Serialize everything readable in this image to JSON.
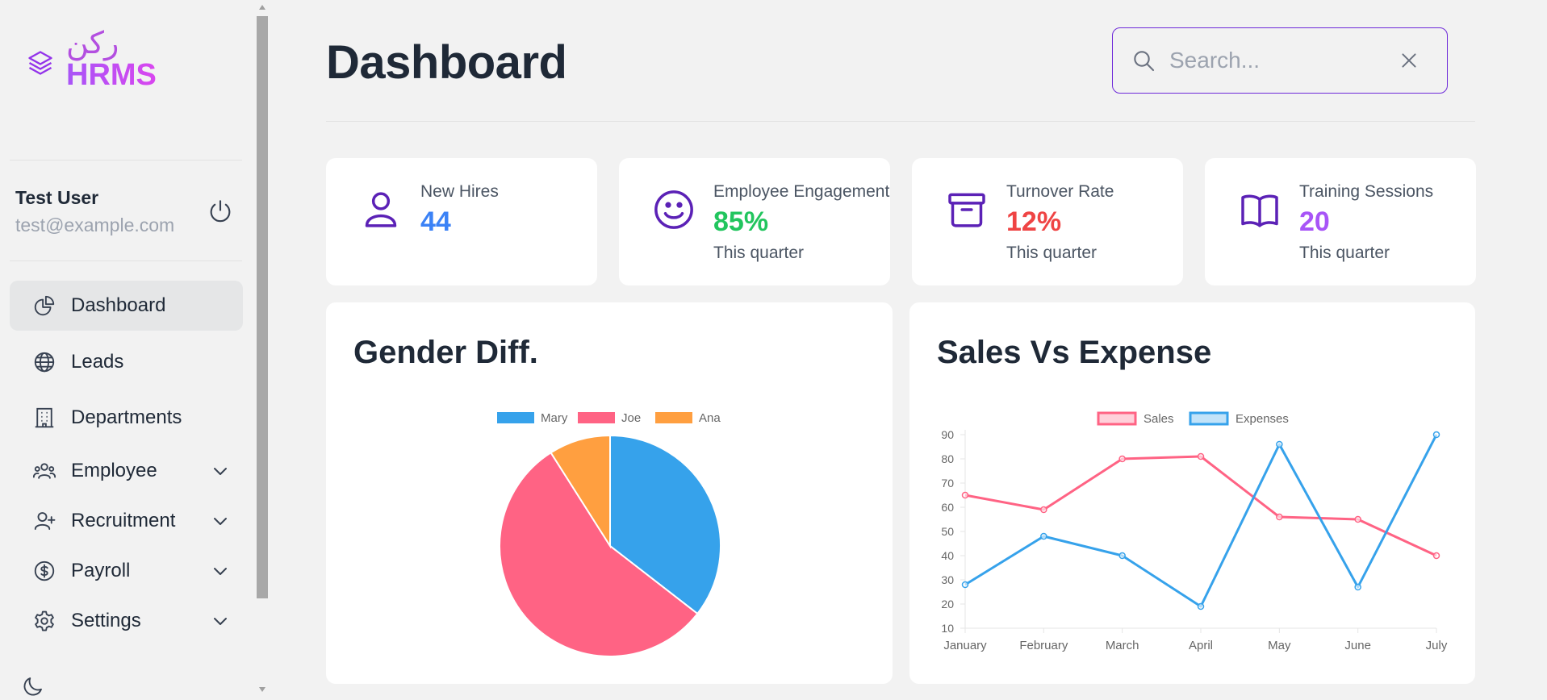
{
  "brand": {
    "arabic": "ركن",
    "name": "HRMS",
    "logo_icon": "layers-icon"
  },
  "user": {
    "name": "Test User",
    "email": "test@example.com"
  },
  "nav": [
    {
      "label": "Dashboard",
      "icon": "pie-chart-icon",
      "active": true,
      "expandable": false
    },
    {
      "label": "Leads",
      "icon": "globe-icon",
      "active": false,
      "expandable": false
    },
    {
      "label": "Departments",
      "icon": "building-icon",
      "active": false,
      "expandable": false
    },
    {
      "label": "Employee",
      "icon": "users-icon",
      "active": false,
      "expandable": true
    },
    {
      "label": "Recruitment",
      "icon": "user-plus-icon",
      "active": false,
      "expandable": true
    },
    {
      "label": "Payroll",
      "icon": "dollar-icon",
      "active": false,
      "expandable": true
    },
    {
      "label": "Settings",
      "icon": "gear-icon",
      "active": false,
      "expandable": true
    }
  ],
  "page": {
    "title": "Dashboard"
  },
  "search": {
    "placeholder": "Search..."
  },
  "stats": [
    {
      "label": "New Hires",
      "value": "44",
      "sub": "",
      "color": "#3b82f6",
      "icon": "user-icon"
    },
    {
      "label": "Employee Engagement",
      "value": "85%",
      "sub": "This quarter",
      "color": "#22c55e",
      "icon": "smile-icon"
    },
    {
      "label": "Turnover Rate",
      "value": "12%",
      "sub": "This quarter",
      "color": "#ef4444",
      "icon": "archive-icon"
    },
    {
      "label": "Training Sessions",
      "value": "20",
      "sub": "This quarter",
      "color": "#a855f7",
      "icon": "book-icon"
    }
  ],
  "panels": {
    "gender_title": "Gender Diff.",
    "sales_title": "Sales Vs Expense"
  },
  "chart_data": [
    {
      "type": "pie",
      "title": "Gender Diff.",
      "legend_position": "top",
      "categories": [
        "Mary",
        "Joe",
        "Ana"
      ],
      "values": [
        35.5,
        55.5,
        9
      ],
      "colors": [
        "#36a2eb",
        "#ff6384",
        "#ff9f40"
      ]
    },
    {
      "type": "line",
      "title": "Sales Vs Expense",
      "legend_position": "top",
      "x": [
        "January",
        "February",
        "March",
        "April",
        "May",
        "June",
        "July"
      ],
      "ylim": [
        10,
        90
      ],
      "yticks": [
        10,
        20,
        30,
        40,
        50,
        60,
        70,
        80,
        90
      ],
      "grid": false,
      "series": [
        {
          "name": "Sales",
          "color": "#ff6384",
          "values": [
            65,
            59,
            80,
            81,
            56,
            55,
            40
          ]
        },
        {
          "name": "Expenses",
          "color": "#36a2eb",
          "values": [
            28,
            48,
            40,
            19,
            86,
            27,
            90
          ]
        }
      ]
    }
  ]
}
